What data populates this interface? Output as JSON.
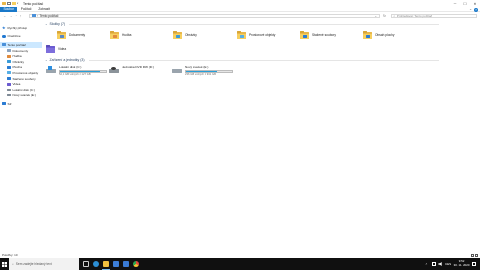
{
  "window": {
    "title": "Tento počítač",
    "minimize_icon": "minimize-icon",
    "maximize_icon": "maximize-icon",
    "close_icon": "close-icon"
  },
  "ribbon": {
    "tabs": [
      "Soubor",
      "Počítač",
      "Zobrazit"
    ],
    "expand_icon": "chevron-down-icon",
    "help_icon": "help-icon"
  },
  "address_bar": {
    "path": "Tento počítač",
    "search_placeholder": "Prohledávat: Tento počítač"
  },
  "sidebar": {
    "items": [
      {
        "label": "Rychlý přístup",
        "icon": "star-icon",
        "color": "#2b7cd3",
        "level": "top"
      },
      {
        "label": "OneDrive",
        "icon": "cloud-icon",
        "color": "#1f78d1",
        "level": "top"
      },
      {
        "label": "Tento počítač",
        "icon": "computer-icon",
        "color": "#4a90d9",
        "level": "top",
        "active": true
      },
      {
        "label": "Dokumenty",
        "icon": "documents-icon",
        "color": "#8aa3bf",
        "level": "sub"
      },
      {
        "label": "Hudba",
        "icon": "music-icon",
        "color": "#e08a3c",
        "level": "sub"
      },
      {
        "label": "Obrázky",
        "icon": "pictures-icon",
        "color": "#3a9bd8",
        "level": "sub"
      },
      {
        "label": "Plocha",
        "icon": "desktop-icon",
        "color": "#2b7cd3",
        "level": "sub"
      },
      {
        "label": "Prostorové objekty",
        "icon": "3d-objects-icon",
        "color": "#55aee6",
        "level": "sub"
      },
      {
        "label": "Stažené soubory",
        "icon": "downloads-icon",
        "color": "#2b7cd3",
        "level": "sub"
      },
      {
        "label": "Videa",
        "icon": "videos-icon",
        "color": "#6b5bd0",
        "level": "sub"
      },
      {
        "label": "Lokální disk (C:)",
        "icon": "drive-icon",
        "color": "#7f8a96",
        "level": "sub"
      },
      {
        "label": "Nový svazek (E:)",
        "icon": "drive-icon",
        "color": "#7f8a96",
        "level": "sub"
      },
      {
        "label": "Síť",
        "icon": "network-icon",
        "color": "#2b7cd3",
        "level": "top"
      }
    ]
  },
  "folders_group": {
    "header": "Složky (7)",
    "items": [
      {
        "label": "Dokumenty",
        "icon": "documents-folder-icon",
        "glyph_color": "#5a88c6"
      },
      {
        "label": "Hudba",
        "icon": "music-folder-icon",
        "glyph_color": "#e08a3c"
      },
      {
        "label": "Obrázky",
        "icon": "pictures-folder-icon",
        "glyph_color": "#3a9bd8"
      },
      {
        "label": "Prostorové objekty",
        "icon": "3d-objects-folder-icon",
        "glyph_color": "#55aee6"
      },
      {
        "label": "Stažené soubory",
        "icon": "downloads-folder-icon",
        "glyph_color": "#2b7cd3"
      },
      {
        "label": "Obsah plochy",
        "icon": "desktop-folder-icon",
        "glyph_color": "#2b7cd3"
      },
      {
        "label": "Videa",
        "icon": "videos-folder-icon",
        "glyph_color": "#6b5bd0"
      }
    ]
  },
  "drives_group": {
    "header": "Zařízení a jednotky (3)",
    "items": [
      {
        "label": "Lokální disk (C:)",
        "icon": "windows-drive-icon",
        "usage_fraction": 0.87,
        "free_text": "52,1 GB volných z 127 GB",
        "bar": true
      },
      {
        "label": "Jednotka DVD RW (D:)",
        "icon": "dvd-drive-icon",
        "bar": false
      },
      {
        "label": "Nový svazek (E:)",
        "icon": "drive-icon",
        "usage_fraction": 0.68,
        "free_text": "236 GB volných z 931 GB",
        "bar": true
      }
    ]
  },
  "status_bar": {
    "items_count": "Položky: 10"
  },
  "taskbar": {
    "start_icon": "windows-start-icon",
    "search_placeholder": "Sem zadejte hledaný text",
    "apps": [
      {
        "icon": "task-view-icon",
        "color": "#cfcfcf"
      },
      {
        "icon": "edge-icon",
        "color": "#2d8fd5"
      },
      {
        "icon": "file-explorer-icon",
        "color": "#f0c040",
        "active": true
      },
      {
        "icon": "store-icon",
        "color": "#3d7fd9"
      },
      {
        "icon": "mail-icon",
        "color": "#3a7bd5"
      },
      {
        "icon": "chrome-icon",
        "color": "#e3483d"
      }
    ],
    "tray": {
      "language": "CES",
      "time": "9:52",
      "date": "30. 11. 2020"
    }
  },
  "colors": {
    "accent": "#1979ca",
    "selection": "#cce8ff",
    "drive_bar": "#26a0da",
    "taskbar": "#101010"
  }
}
